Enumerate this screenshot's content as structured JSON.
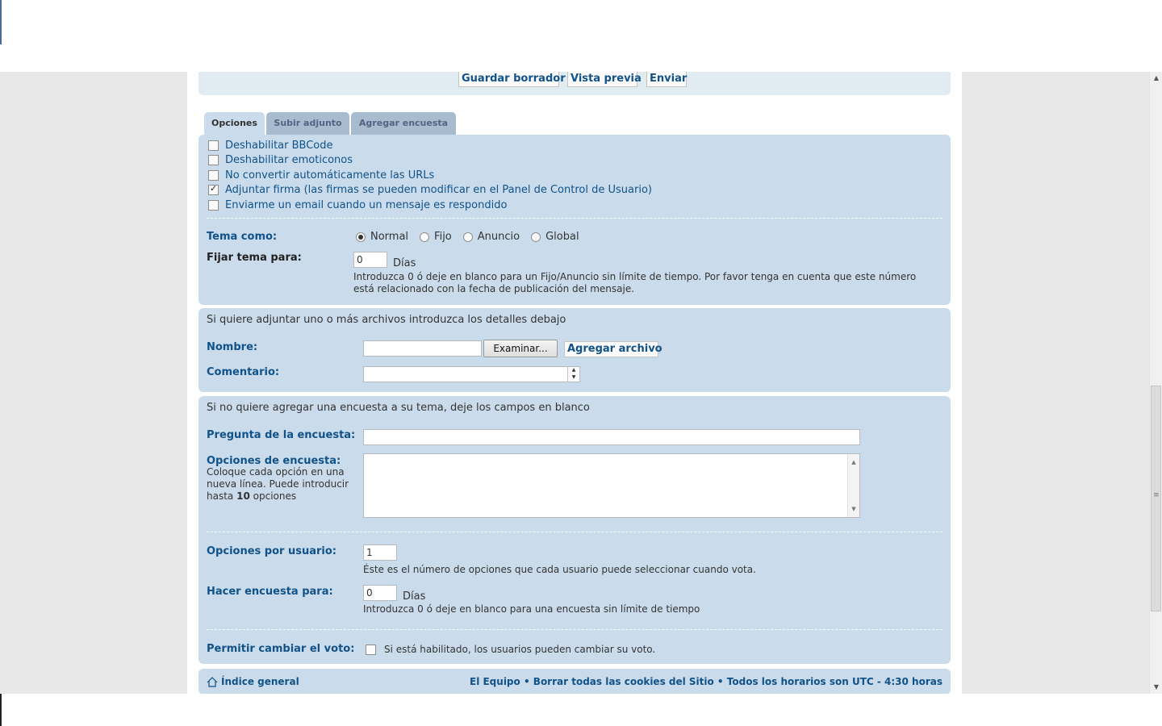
{
  "actions": {
    "save_draft": "Guardar borrador",
    "preview": "Vista previa",
    "submit": "Enviar"
  },
  "tabs": [
    {
      "label": "Opciones",
      "active": true
    },
    {
      "label": "Subir adjunto",
      "active": false
    },
    {
      "label": "Agregar encuesta",
      "active": false
    }
  ],
  "options": {
    "checkboxes": [
      {
        "label": "Deshabilitar BBCode",
        "checked": false
      },
      {
        "label": "Deshabilitar emoticonos",
        "checked": false
      },
      {
        "label": "No convertir automáticamente las URLs",
        "checked": false
      },
      {
        "label": "Adjuntar firma (las firmas se pueden modificar en el Panel de Control de Usuario)",
        "checked": true
      },
      {
        "label": "Enviarme un email cuando un mensaje es respondido",
        "checked": false
      }
    ],
    "topic_type_label": "Tema como:",
    "topic_types": [
      "Normal",
      "Fijo",
      "Anuncio",
      "Global"
    ],
    "topic_type_selected": "Normal",
    "stick_for_label": "Fijar tema para:",
    "stick_for_value": "0",
    "stick_for_unit": "Días",
    "stick_for_help_1": "Introduzca 0 ó deje en blanco para un Fijo/Anuncio sin límite de tiempo. Por favor tenga en cuenta que este número",
    "stick_for_help_2": "está relacionado con la fecha de publicación del mensaje."
  },
  "attachments": {
    "intro": "Si quiere adjuntar uno o más archivos introduzca los detalles debajo",
    "filename_label": "Nombre:",
    "browse_label": "Examinar...",
    "add_file_label": "Agregar archivo",
    "comment_label": "Comentario:"
  },
  "poll": {
    "intro": "Si no quiere agregar una encuesta a su tema, deje los campos en blanco",
    "question_label": "Pregunta de la encuesta:",
    "options_label": "Opciones de encuesta:",
    "options_help_1": "Coloque cada opción en una",
    "options_help_2": "nueva línea. Puede introducir",
    "options_help_3a": "hasta",
    "options_help_3b": "10",
    "options_help_3c": "opciones",
    "per_user_label": "Opciones por usuario:",
    "per_user_value": "1",
    "per_user_help": "Éste es el número de opciones que cada usuario puede seleccionar cuando vota.",
    "length_label": "Hacer encuesta para:",
    "length_value": "0",
    "length_unit": "Días",
    "length_help": "Introduzca 0 ó deje en blanco para una encuesta sin límite de tiempo",
    "change_vote_label": "Permitir cambiar el voto:",
    "change_vote_help": "Si está habilitado, los usuarios pueden cambiar su voto.",
    "change_vote_checked": false
  },
  "footer": {
    "home_label": "Índice general",
    "links": "El Equipo • Borrar todas las cookies del Sitio • Todos los horarios son UTC - 4:30 horas"
  }
}
